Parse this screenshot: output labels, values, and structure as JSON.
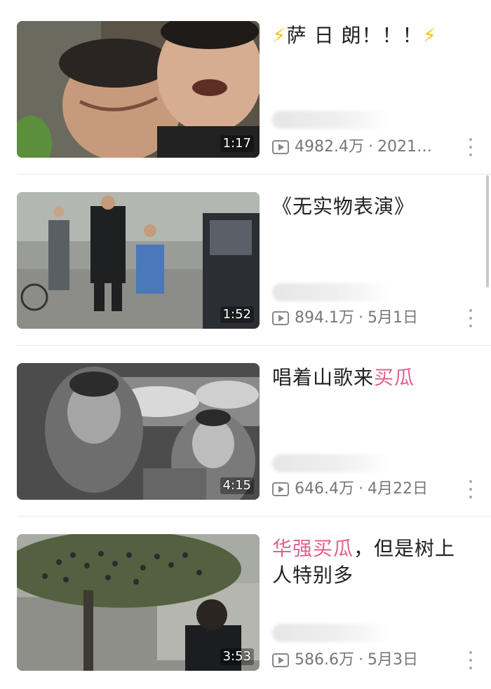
{
  "videos": [
    {
      "title_parts": [
        {
          "text": "⚡",
          "cls": "bolt"
        },
        {
          "text": "萨 日 朗！！！",
          "cls": ""
        },
        {
          "text": "⚡",
          "cls": "bolt"
        }
      ],
      "duration": "1:17",
      "views": "4982.4万",
      "date": "2021…",
      "thumb_icon": "crying-men-thumbnail"
    },
    {
      "title_parts": [
        {
          "text": "《无实物表演》",
          "cls": ""
        }
      ],
      "duration": "1:52",
      "views": "894.1万",
      "date": "5月1日",
      "thumb_icon": "street-scene-thumbnail"
    },
    {
      "title_parts": [
        {
          "text": "唱着山歌来",
          "cls": ""
        },
        {
          "text": "买瓜",
          "cls": "hl"
        }
      ],
      "duration": "4:15",
      "views": "646.4万",
      "date": "4月22日",
      "thumb_icon": "melon-stall-thumbnail"
    },
    {
      "title_parts": [
        {
          "text": "华强买瓜",
          "cls": "hl"
        },
        {
          "text": "，但是树上人特别多",
          "cls": ""
        }
      ],
      "duration": "3:53",
      "views": "586.6万",
      "date": "5月3日",
      "thumb_icon": "crowd-in-tree-thumbnail"
    }
  ],
  "colors": {
    "highlight": "#e0608c",
    "meta": "#777777",
    "bolt": "#f5c518"
  }
}
